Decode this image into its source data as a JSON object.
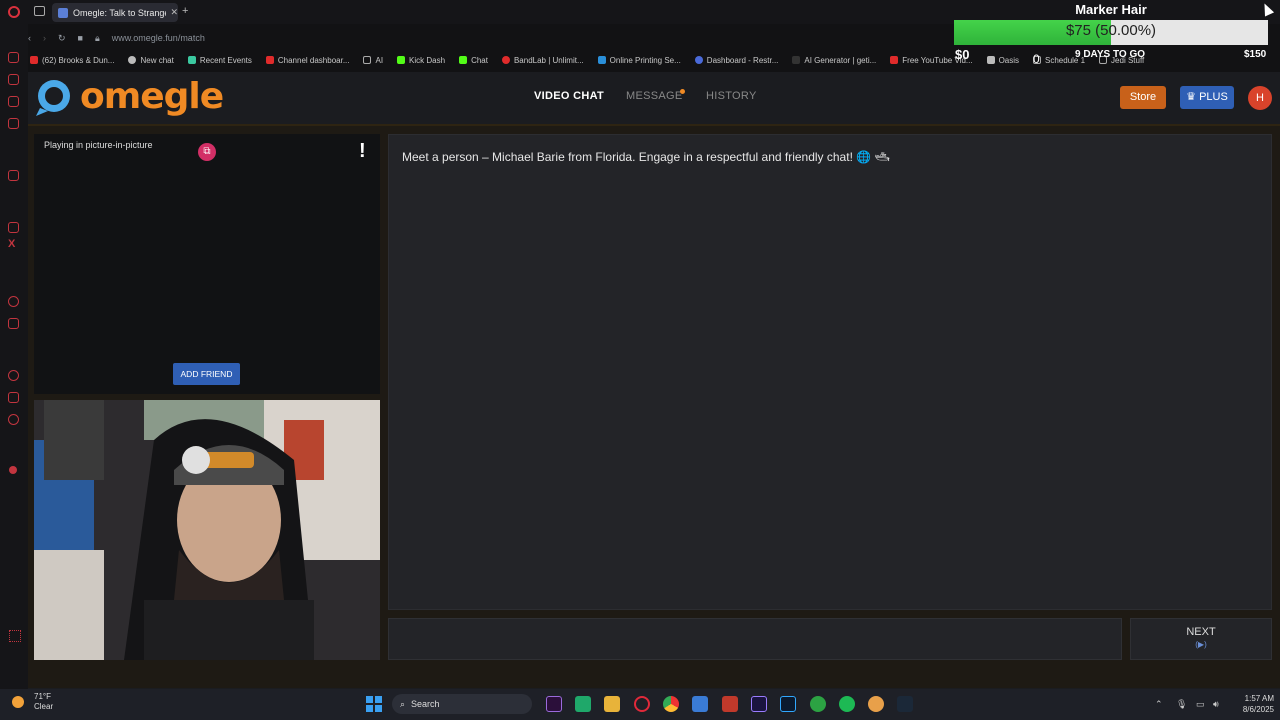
{
  "browser": {
    "tab_title": "Omegle: Talk to Strangers",
    "url": "www.omegle.fun/match",
    "bookmarks": [
      "(62) Brooks & Dun...",
      "New chat",
      "Recent Events",
      "Channel dashboar...",
      "AI",
      "Kick Dash",
      "Chat",
      "BandLab | Unlimit...",
      "Online Printing Se...",
      "Dashboard - Restr...",
      "AI Generator | geti...",
      "Free YouTube Vid...",
      "Oasis",
      "Schedule 1",
      "Jedi Stuff"
    ]
  },
  "overlay": {
    "goal_title": "Marker Hair",
    "goal_amount": "$75 (50.00%)",
    "goal_progress": 0.5,
    "goal_min": "$0",
    "goal_max": "$150",
    "days_left": "9 DAYS TO GO",
    "zero_label": "0"
  },
  "site": {
    "logo": "omegle",
    "nav": {
      "video_chat": "VIDEO CHAT",
      "message": "MESSAGE",
      "history": "HISTORY"
    },
    "store": "Store",
    "plus": "PLUS",
    "avatar_initial": "H"
  },
  "video": {
    "pip_label": "Playing in picture-in-picture",
    "report": "!",
    "add_friend": "ADD FRIEND"
  },
  "chat": {
    "message": "Meet a person – Michael Barie from Florida. Engage in a respectful and friendly chat! 🌐 🛥",
    "next": "NEXT",
    "next_key": "(▶)"
  },
  "taskbar": {
    "weather_temp": "71°F",
    "weather_desc": "Clear",
    "search": "Search",
    "time": "1:57 AM",
    "date": "8/6/2025"
  },
  "colors": {
    "accent": "#f08a24",
    "plus_blue": "#2f5fb5",
    "goal_green": "#3fcc45"
  }
}
